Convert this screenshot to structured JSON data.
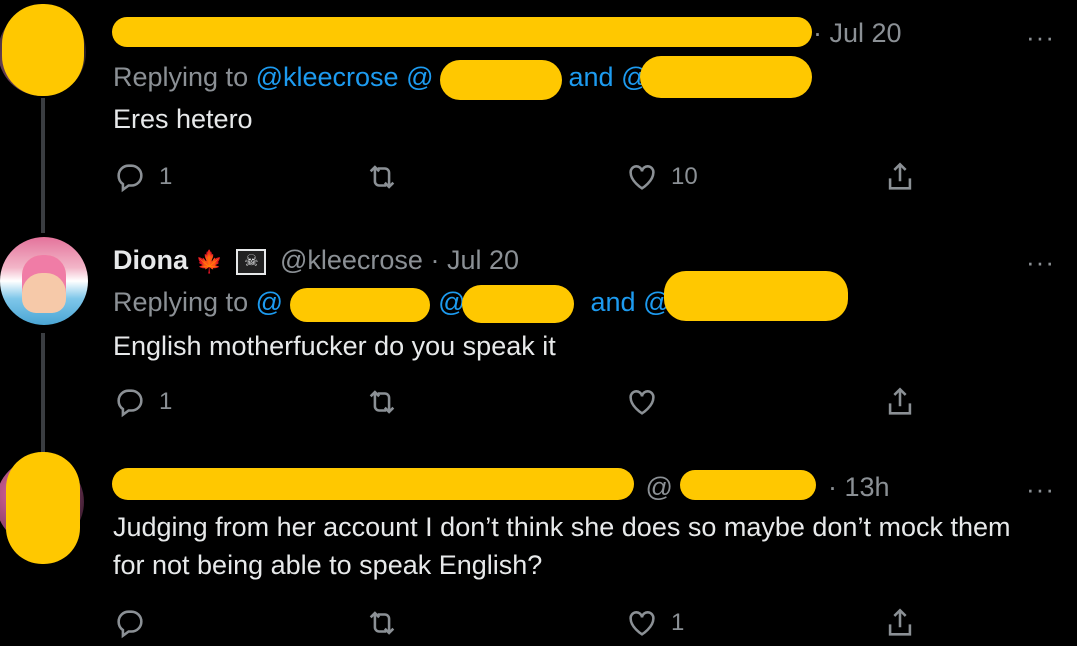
{
  "tweets": [
    {
      "name": "",
      "handle": "",
      "date": "· Jul 20",
      "replying_prefix": "Replying to",
      "replying_mention": "@kleecrose @",
      "replying_and": "and @",
      "text": "Eres hetero",
      "replies": "1",
      "retweets": "",
      "likes": "10"
    },
    {
      "name": "Diona",
      "handle": "@kleecrose",
      "date": "· Jul 20",
      "replying_prefix": "Replying to",
      "replying_mention": "@",
      "replying_mention2": "@",
      "replying_and": "and @",
      "text": "English motherfucker do you speak it",
      "replies": "1",
      "retweets": "",
      "likes": ""
    },
    {
      "name": "",
      "handle": "@",
      "date": "· 13h",
      "text_line1": "Judging from her account I don’t think she does so maybe don’t mock them",
      "text_line2": "for not being able to speak English?",
      "replies": "",
      "retweets": "",
      "likes": "1"
    }
  ],
  "icons": {
    "more": "···",
    "flag": "maple-leaf-icon",
    "pirate": "skull-crossbones-icon"
  },
  "colors": {
    "background": "#000000",
    "mention": "#1d9bf0",
    "redaction": "#ffc800",
    "muted": "#8b9095"
  }
}
